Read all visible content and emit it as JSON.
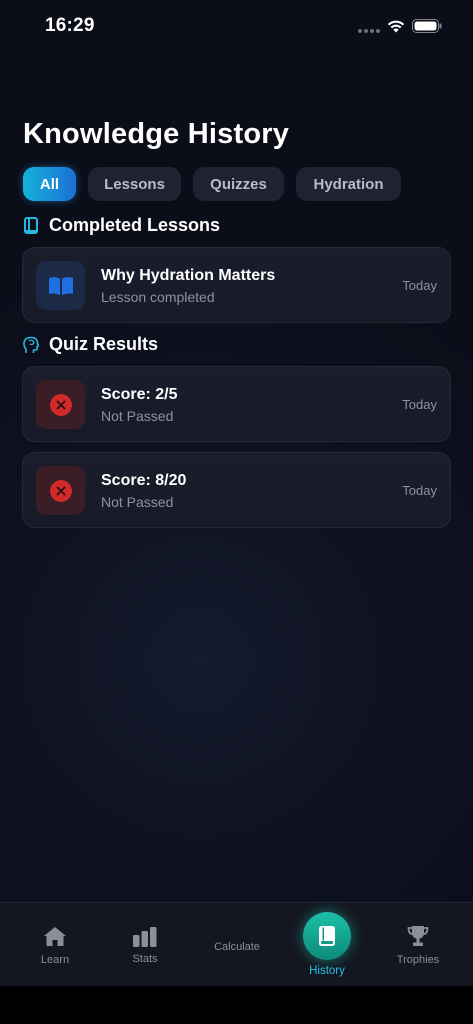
{
  "status_bar": {
    "time": "16:29"
  },
  "page_title": "Knowledge History",
  "filters": [
    {
      "label": "All",
      "active": true
    },
    {
      "label": "Lessons",
      "active": false
    },
    {
      "label": "Quizzes",
      "active": false
    },
    {
      "label": "Hydration",
      "active": false
    }
  ],
  "sections": {
    "lessons": {
      "title": "Completed Lessons",
      "icon": "book-icon",
      "items": [
        {
          "title": "Why Hydration Matters",
          "subtitle": "Lesson completed",
          "date": "Today",
          "icon": "open-book-icon"
        }
      ]
    },
    "quizzes": {
      "title": "Quiz Results",
      "icon": "head-brain-icon",
      "items": [
        {
          "title": "Score: 2/5",
          "subtitle": "Not Passed",
          "date": "Today",
          "icon": "x-circle-icon"
        },
        {
          "title": "Score: 8/20",
          "subtitle": "Not Passed",
          "date": "Today",
          "icon": "x-circle-icon"
        }
      ]
    }
  },
  "tab_bar": {
    "items": [
      {
        "label": "Learn",
        "icon": "house-icon",
        "active": false
      },
      {
        "label": "Stats",
        "icon": "bar-chart-icon",
        "active": false
      },
      {
        "label": "Calculate",
        "icon": "",
        "active": false
      },
      {
        "label": "History",
        "icon": "book-icon",
        "active": true
      },
      {
        "label": "Trophies",
        "icon": "trophy-icon",
        "active": false
      }
    ]
  },
  "colors": {
    "accent_cyan": "#14b3d9",
    "accent_teal": "#1cc0a8",
    "fail_red": "#d02a2a",
    "background": "#0f1221"
  }
}
